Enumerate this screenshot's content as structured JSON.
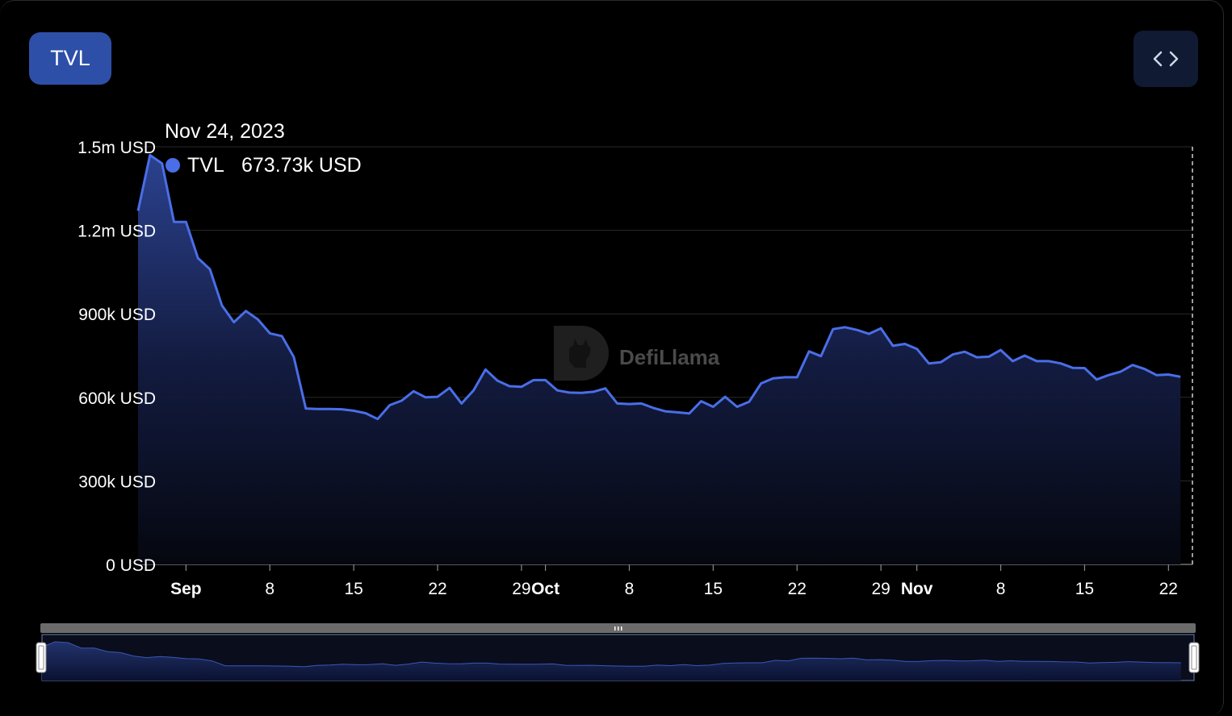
{
  "toolbar": {
    "metric_button": "TVL"
  },
  "tooltip": {
    "date": "Nov 24, 2023",
    "series": "TVL",
    "value": "673.73k USD"
  },
  "watermark": "DefiLlama",
  "colors": {
    "line": "#4a6ee8",
    "button": "#2e4fa8",
    "background": "#000000"
  },
  "icons": {
    "embed": "code-brackets-icon",
    "watermark_logo": "llama-logo-icon",
    "slider_handle": "drag-handle-icon"
  },
  "chart_data": {
    "type": "area",
    "title": "",
    "xlabel": "",
    "ylabel": "",
    "ylim": [
      0,
      1500000
    ],
    "y_ticks": [
      {
        "value": 0,
        "label": "0 USD"
      },
      {
        "value": 300000,
        "label": "300k USD"
      },
      {
        "value": 600000,
        "label": "600k USD"
      },
      {
        "value": 900000,
        "label": "900k USD"
      },
      {
        "value": 1200000,
        "label": "1.2m USD"
      },
      {
        "value": 1500000,
        "label": "1.5m USD"
      }
    ],
    "x_range": [
      "2023-08-28",
      "2023-11-24"
    ],
    "x_ticks": [
      {
        "date": "2023-09-01",
        "label": "Sep",
        "bold": true
      },
      {
        "date": "2023-09-08",
        "label": "8",
        "bold": false
      },
      {
        "date": "2023-09-15",
        "label": "15",
        "bold": false
      },
      {
        "date": "2023-09-22",
        "label": "22",
        "bold": false
      },
      {
        "date": "2023-09-29",
        "label": "29",
        "bold": false
      },
      {
        "date": "2023-10-01",
        "label": "Oct",
        "bold": true
      },
      {
        "date": "2023-10-08",
        "label": "8",
        "bold": false
      },
      {
        "date": "2023-10-15",
        "label": "15",
        "bold": false
      },
      {
        "date": "2023-10-22",
        "label": "22",
        "bold": false
      },
      {
        "date": "2023-10-29",
        "label": "29",
        "bold": false
      },
      {
        "date": "2023-11-01",
        "label": "Nov",
        "bold": true
      },
      {
        "date": "2023-11-08",
        "label": "8",
        "bold": false
      },
      {
        "date": "2023-11-15",
        "label": "15",
        "bold": false
      },
      {
        "date": "2023-11-22",
        "label": "22",
        "bold": false
      }
    ],
    "grid": true,
    "series": [
      {
        "name": "TVL",
        "points": [
          [
            "2023-08-28",
            1270000
          ],
          [
            "2023-08-29",
            1470000
          ],
          [
            "2023-08-30",
            1440000
          ],
          [
            "2023-08-31",
            1230000
          ],
          [
            "2023-09-01",
            1230000
          ],
          [
            "2023-09-02",
            1100000
          ],
          [
            "2023-09-03",
            1060000
          ],
          [
            "2023-09-04",
            930000
          ],
          [
            "2023-09-05",
            870000
          ],
          [
            "2023-09-06",
            910000
          ],
          [
            "2023-09-07",
            880000
          ],
          [
            "2023-09-08",
            830000
          ],
          [
            "2023-09-09",
            820000
          ],
          [
            "2023-09-10",
            745000
          ],
          [
            "2023-09-11",
            560000
          ],
          [
            "2023-09-12",
            558000
          ],
          [
            "2023-09-13",
            558000
          ],
          [
            "2023-09-14",
            557000
          ],
          [
            "2023-09-15",
            552000
          ],
          [
            "2023-09-16",
            543000
          ],
          [
            "2023-09-17",
            522000
          ],
          [
            "2023-09-18",
            572000
          ],
          [
            "2023-09-19",
            588000
          ],
          [
            "2023-09-20",
            622000
          ],
          [
            "2023-09-21",
            600000
          ],
          [
            "2023-09-22",
            602000
          ],
          [
            "2023-09-23",
            634000
          ],
          [
            "2023-09-24",
            578000
          ],
          [
            "2023-09-25",
            625000
          ],
          [
            "2023-09-26",
            700000
          ],
          [
            "2023-09-27",
            660000
          ],
          [
            "2023-09-28",
            640000
          ],
          [
            "2023-09-29",
            638000
          ],
          [
            "2023-09-30",
            662000
          ],
          [
            "2023-10-01",
            662000
          ],
          [
            "2023-10-02",
            625000
          ],
          [
            "2023-10-03",
            617000
          ],
          [
            "2023-10-04",
            616000
          ],
          [
            "2023-10-05",
            620000
          ],
          [
            "2023-10-06",
            632000
          ],
          [
            "2023-10-07",
            578000
          ],
          [
            "2023-10-08",
            576000
          ],
          [
            "2023-10-09",
            578000
          ],
          [
            "2023-10-10",
            562000
          ],
          [
            "2023-10-11",
            550000
          ],
          [
            "2023-10-12",
            546000
          ],
          [
            "2023-10-13",
            542000
          ],
          [
            "2023-10-14",
            586000
          ],
          [
            "2023-10-15",
            566000
          ],
          [
            "2023-10-16",
            602000
          ],
          [
            "2023-10-17",
            566000
          ],
          [
            "2023-10-18",
            584000
          ],
          [
            "2023-10-19",
            650000
          ],
          [
            "2023-10-20",
            668000
          ],
          [
            "2023-10-21",
            672000
          ],
          [
            "2023-10-22",
            672000
          ],
          [
            "2023-10-23",
            765000
          ],
          [
            "2023-10-24",
            748000
          ],
          [
            "2023-10-25",
            845000
          ],
          [
            "2023-10-26",
            852000
          ],
          [
            "2023-10-27",
            842000
          ],
          [
            "2023-10-28",
            828000
          ],
          [
            "2023-10-29",
            848000
          ],
          [
            "2023-10-30",
            785000
          ],
          [
            "2023-10-31",
            792000
          ],
          [
            "2023-11-01",
            774000
          ],
          [
            "2023-11-02",
            722000
          ],
          [
            "2023-11-03",
            726000
          ],
          [
            "2023-11-04",
            754000
          ],
          [
            "2023-11-05",
            764000
          ],
          [
            "2023-11-06",
            744000
          ],
          [
            "2023-11-07",
            746000
          ],
          [
            "2023-11-08",
            770000
          ],
          [
            "2023-11-09",
            730000
          ],
          [
            "2023-11-10",
            750000
          ],
          [
            "2023-11-11",
            730000
          ],
          [
            "2023-11-12",
            730000
          ],
          [
            "2023-11-13",
            722000
          ],
          [
            "2023-11-14",
            706000
          ],
          [
            "2023-11-15",
            705000
          ],
          [
            "2023-11-16",
            664000
          ],
          [
            "2023-11-17",
            680000
          ],
          [
            "2023-11-18",
            692000
          ],
          [
            "2023-11-19",
            716000
          ],
          [
            "2023-11-20",
            702000
          ],
          [
            "2023-11-21",
            680000
          ],
          [
            "2023-11-22",
            682000
          ],
          [
            "2023-11-23",
            673730
          ]
        ]
      }
    ]
  }
}
